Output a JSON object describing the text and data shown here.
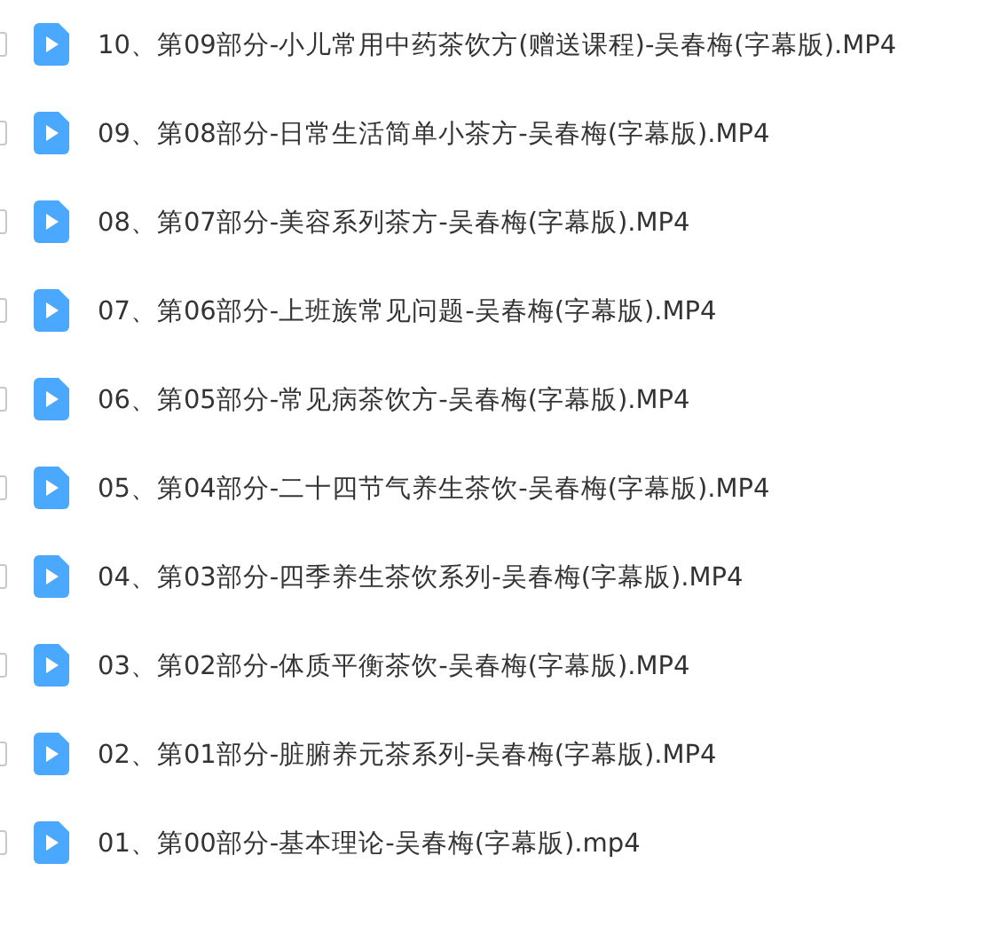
{
  "files": [
    {
      "name": "10、第09部分-小儿常用中药茶饮方(赠送课程)-吴春梅(字幕版).MP4",
      "checked": false
    },
    {
      "name": "09、第08部分-日常生活简单小茶方-吴春梅(字幕版).MP4",
      "checked": false
    },
    {
      "name": "08、第07部分-美容系列茶方-吴春梅(字幕版).MP4",
      "checked": false
    },
    {
      "name": "07、第06部分-上班族常见问题-吴春梅(字幕版).MP4",
      "checked": false
    },
    {
      "name": "06、第05部分-常见病茶饮方-吴春梅(字幕版).MP4",
      "checked": false
    },
    {
      "name": "05、第04部分-二十四节气养生茶饮-吴春梅(字幕版).MP4",
      "checked": false
    },
    {
      "name": "04、第03部分-四季养生茶饮系列-吴春梅(字幕版).MP4",
      "checked": false
    },
    {
      "name": "03、第02部分-体质平衡茶饮-吴春梅(字幕版).MP4",
      "checked": false
    },
    {
      "name": "02、第01部分-脏腑养元茶系列-吴春梅(字幕版).MP4",
      "checked": false
    },
    {
      "name": "01、第00部分-基本理论-吴春梅(字幕版).mp4",
      "checked": false
    }
  ]
}
